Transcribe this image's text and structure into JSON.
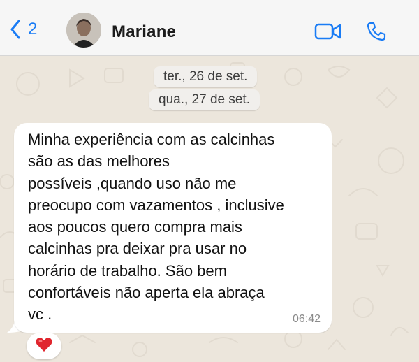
{
  "header": {
    "back_count": "2",
    "contact_name": "Mariane"
  },
  "dates": [
    {
      "label": "ter., 26 de set."
    },
    {
      "label": "qua., 27 de set."
    }
  ],
  "message": {
    "text": "Minha experiência com as calcinhas\nsão as das melhores\npossíveis ,quando uso não me\npreocupo com vazamentos , inclusive\naos poucos quero compra mais\ncalcinhas pra deixar pra usar no\nhorário de trabalho. São bem\nconfortáveis não aperta ela abraça\nvc .",
    "time": "06:42",
    "reaction": "heart"
  },
  "colors": {
    "accent": "#1a7cf5",
    "header_bg": "#f6f6f6",
    "chat_bg": "#ece6dc",
    "bubble_bg": "#ffffff",
    "reaction": "#e0262e"
  },
  "icons": {
    "back": "chevron-left-icon",
    "video": "video-camera-icon",
    "phone": "phone-icon",
    "reaction": "heart-icon"
  }
}
